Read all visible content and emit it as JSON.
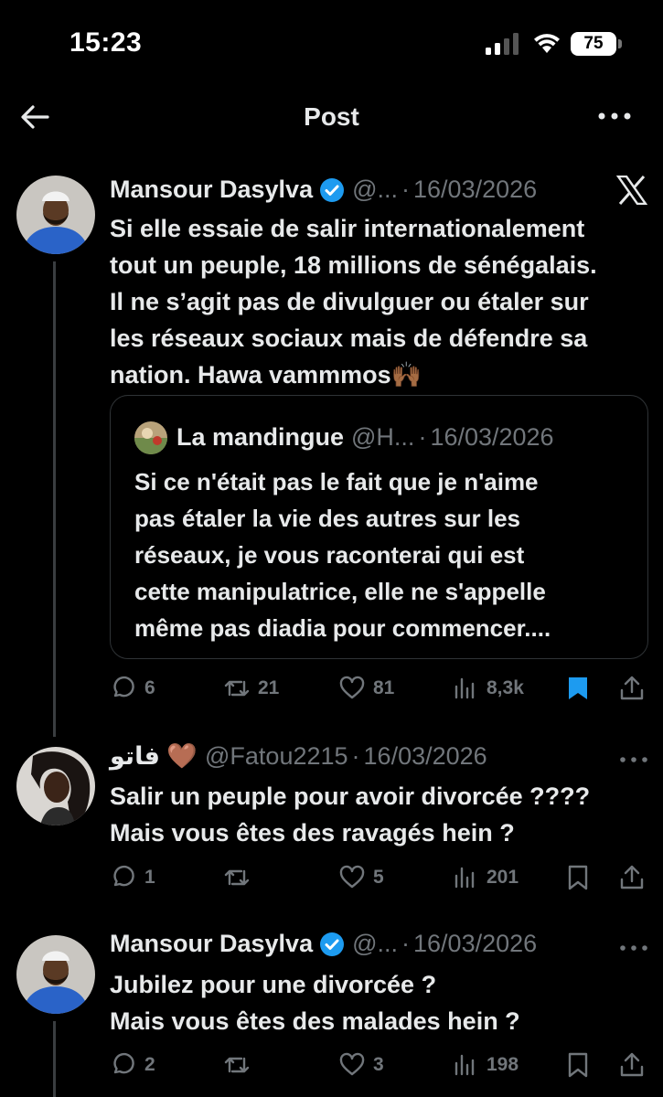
{
  "status_bar": {
    "time": "15:23",
    "battery": "75"
  },
  "nav": {
    "title": "Post"
  },
  "main_post": {
    "name": "Mansour Dasylva",
    "handle": "@...",
    "date": "16/03/2026",
    "text_lines": [
      "Si elle essaie de salir internationalement",
      "tout un peuple, 18 millions de sénégalais.",
      "Il ne s’agit pas de divulguer ou étaler sur",
      "les réseaux sociaux mais de défendre sa",
      "nation. Hawa vammmos🙌🏾"
    ],
    "quote": {
      "name": "La mandingue",
      "handle": "@H...",
      "date": "16/03/2026",
      "text_lines": [
        "Si ce n'était pas le fait que je n'aime",
        "pas étaler la vie des autres sur les",
        "réseaux, je vous raconterai qui est",
        "cette manipulatrice, elle ne s'appelle",
        "même pas diadia pour commencer...."
      ]
    },
    "replies": "6",
    "reposts": "21",
    "likes": "81",
    "views": "8,3k"
  },
  "reply_1": {
    "name": "فاتو 🤎",
    "handle": "@Fatou2215",
    "date": "16/03/2026",
    "text_lines": [
      "Salir un peuple pour avoir divorcée ????",
      "Mais vous êtes des ravagés hein ?"
    ],
    "replies": "1",
    "reposts": "",
    "likes": "5",
    "views": "201"
  },
  "reply_2": {
    "name": "Mansour Dasylva",
    "handle": "@...",
    "date": "16/03/2026",
    "text_lines": [
      "Jubilez pour une divorcée ?",
      "Mais vous êtes des malades hein ?"
    ],
    "replies": "2",
    "reposts": "",
    "likes": "3",
    "views": "198"
  },
  "colors": {
    "background": "#000000",
    "text": "#e7e9ea",
    "muted": "#71767b",
    "verified": "#1d9bf0",
    "bookmark_active": "#1d9bf0",
    "border": "#2f3336"
  },
  "icons": [
    "back-arrow-icon",
    "more-icon",
    "x-logo-icon",
    "verified-icon",
    "reply-icon",
    "repost-icon",
    "like-icon",
    "views-icon",
    "bookmark-icon",
    "share-icon"
  ]
}
